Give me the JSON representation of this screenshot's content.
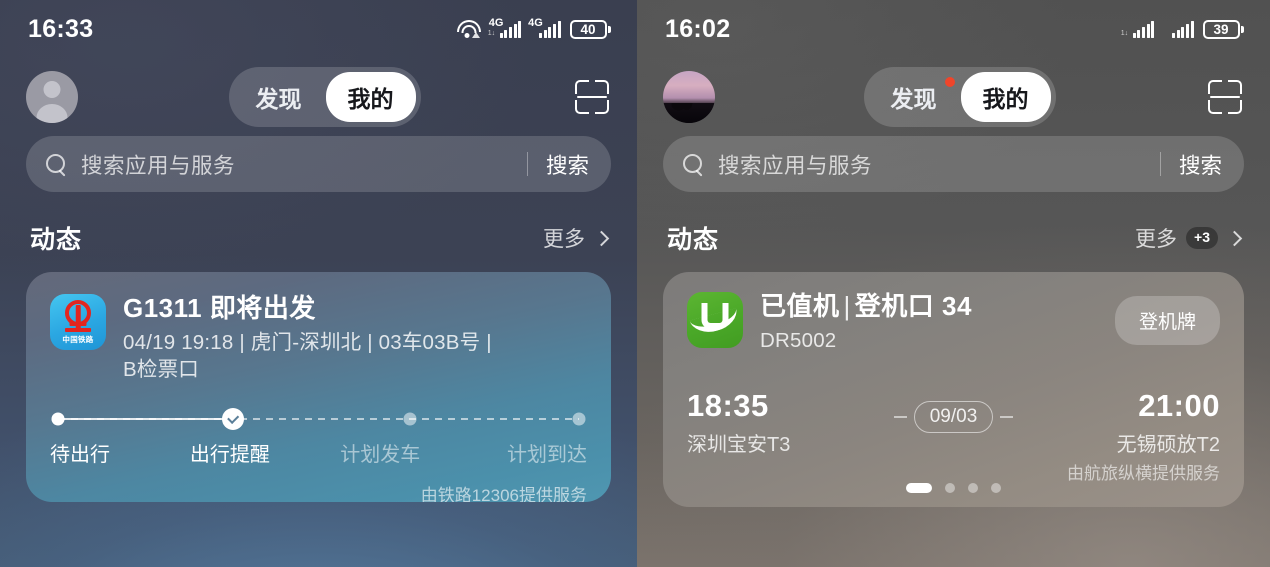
{
  "left": {
    "status": {
      "time": "16:33",
      "battery": "40",
      "network_1": "4G",
      "network_2": "4G",
      "wifi": "wifi-icon"
    },
    "nav": {
      "avatar": "default-avatar",
      "tab_discover": "发现",
      "tab_mine": "我的",
      "scan": "scan-icon"
    },
    "search": {
      "placeholder": "搜索应用与服务",
      "button": "搜索",
      "icon": "search-icon"
    },
    "section": {
      "title": "动态",
      "more": "更多",
      "chevron": "chevron-right-icon"
    },
    "card": {
      "app_icon": "china-railway-icon",
      "app_icon_label": "中国铁路",
      "title": "G1311 即将出发",
      "subtitle_parts": [
        "04/19 19:18",
        "虎门-深圳北",
        "03车03B号",
        "B检票口"
      ],
      "subtitle_line1": "04/19 19:18  |  虎门-深圳北  |  03车03B号  |",
      "subtitle_line2": "B检票口",
      "steps": [
        {
          "label": "待出行",
          "state": "done"
        },
        {
          "label": "出行提醒",
          "state": "current"
        },
        {
          "label": "计划发车",
          "state": "pending"
        },
        {
          "label": "计划到达",
          "state": "pending"
        }
      ],
      "provider": "由铁路12306提供服务"
    }
  },
  "right": {
    "status": {
      "time": "16:02",
      "battery": "39"
    },
    "nav": {
      "avatar": "photo-avatar",
      "tab_discover": "发现",
      "tab_mine": "我的",
      "scan": "scan-icon",
      "discover_badge": "red-dot"
    },
    "search": {
      "placeholder": "搜索应用与服务",
      "button": "搜索",
      "icon": "search-icon"
    },
    "section": {
      "title": "动态",
      "more": "更多",
      "badge": "+3",
      "chevron": "chevron-right-icon"
    },
    "card": {
      "app_icon": "umetrip-icon",
      "title_status": "已值机",
      "title_sep": "|",
      "title_gate": "登机口 34",
      "flight_no": "DR5002",
      "action_button": "登机牌",
      "depart_time": "18:35",
      "depart_airport": "深圳宝安T3",
      "date": "09/03",
      "arrive_time": "21:00",
      "arrive_airport": "无锡硕放T2",
      "provider": "由航旅纵横提供服务",
      "pager": {
        "total": 4,
        "active": 1
      }
    }
  }
}
